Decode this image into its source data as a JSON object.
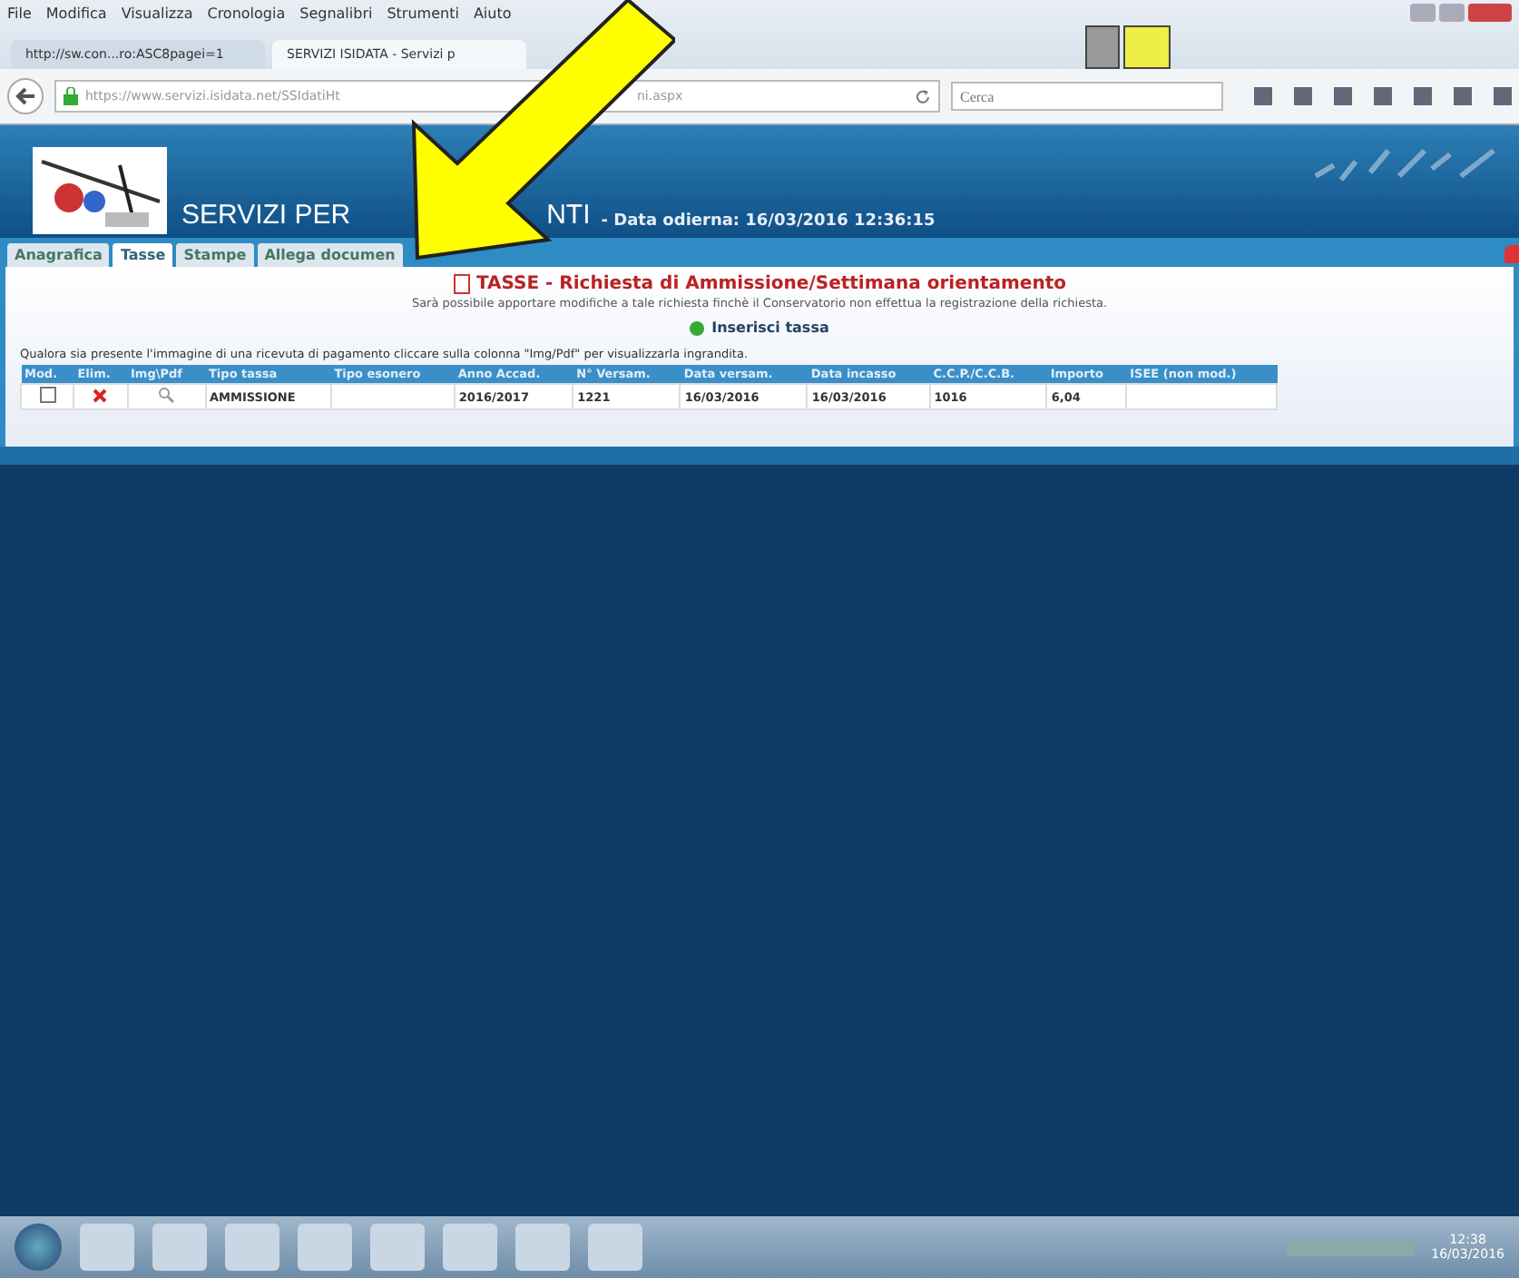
{
  "menu": [
    "File",
    "Modifica",
    "Visualizza",
    "Cronologia",
    "Segnalibri",
    "Strumenti",
    "Aiuto"
  ],
  "browser_tabs": [
    {
      "title": "http://sw.con...ro:ASC8pagei=1",
      "selected": false
    },
    {
      "title": "SERVIZI ISIDATA - Servizi p",
      "selected": true
    }
  ],
  "address_bar": {
    "url": "https://www.servizi.isidata.net/SSIdatiHt",
    "url_tail": "ni.aspx"
  },
  "search": {
    "placeholder": "Cerca"
  },
  "header": {
    "title_left": "SERVIZI PER",
    "title_right": "NTI",
    "date": "- Data odierna: 16/03/2016 12:36:15"
  },
  "tabs": [
    {
      "label": "Anagrafica",
      "selected": false
    },
    {
      "label": "Tasse",
      "selected": true
    },
    {
      "label": "Stampe",
      "selected": false
    },
    {
      "label": "Allega documen",
      "selected": false
    }
  ],
  "page": {
    "title": "TASSE - Richiesta di Ammissione/Settimana orientamento",
    "notice": "Sarà possibile apportare modifiche a tale richiesta finchè il Conservatorio non effettua la registrazione della richiesta.",
    "add_link": "Inserisci tassa",
    "hint": "Qualora sia presente l'immagine di una ricevuta di pagamento cliccare sulla colonna \"Img/Pdf\" per visualizzarla ingrandita."
  },
  "table": {
    "columns": [
      "Mod.",
      "Elim.",
      "Img\\Pdf",
      "Tipo tassa",
      "Tipo esonero",
      "Anno Accad.",
      "N° Versam.",
      "Data versam.",
      "Data incasso",
      "C.C.P./C.C.B.",
      "Importo",
      "ISEE (non mod.)"
    ],
    "rows": [
      {
        "cells": [
          "",
          "",
          "",
          "AMMISSIONE",
          "",
          "2016/2017",
          "1221",
          "16/03/2016",
          "16/03/2016",
          "1016",
          "6,04",
          ""
        ]
      }
    ]
  },
  "taskbar": {
    "time": "12:38",
    "date": "16/03/2016"
  }
}
